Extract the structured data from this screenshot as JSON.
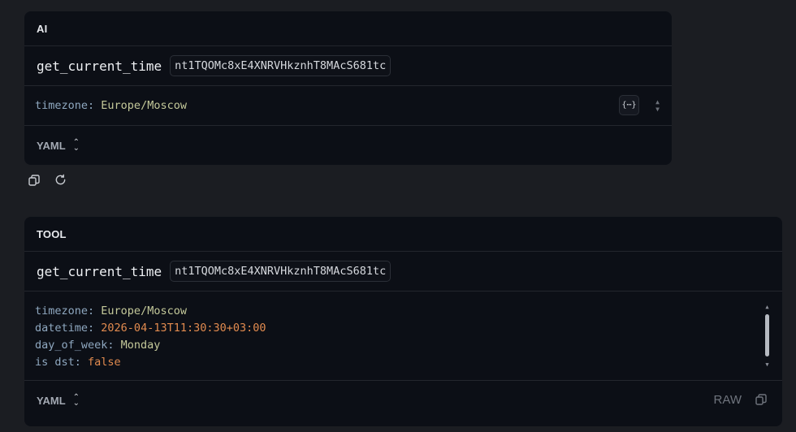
{
  "messages": [
    {
      "role": "AI",
      "function_name": "get_current_time",
      "call_id": "nt1TQOMc8xE4XNRVHkznhT8MAcS681tc",
      "args": [
        {
          "key": "timezone",
          "value": "Europe/Moscow"
        }
      ],
      "format": "YAML",
      "expr_button_label": "{⋯}"
    },
    {
      "role": "TOOL",
      "function_name": "get_current_time",
      "call_id": "nt1TQOMc8xE4XNRVHkznhT8MAcS681tc",
      "result": [
        {
          "key": "timezone",
          "value": "Europe/Moscow"
        },
        {
          "key": "datetime",
          "value": "2026-04-13T11:30:30+03:00"
        },
        {
          "key": "day_of_week",
          "value": "Monday"
        },
        {
          "key": "is dst",
          "value": "false"
        }
      ],
      "format": "YAML",
      "raw_label": "RAW"
    }
  ],
  "icons": {
    "copy": "copy-icon",
    "refresh": "refresh-icon",
    "chevron_updown": "chevron-updown-icon",
    "json_expr": "curly-braces-icon"
  },
  "colors": {
    "background": "#1b1d22",
    "card": "#0c0f16",
    "key": "#8fa8c0",
    "string_value": "#c4c99a",
    "literal_value": "#e28b4f"
  }
}
